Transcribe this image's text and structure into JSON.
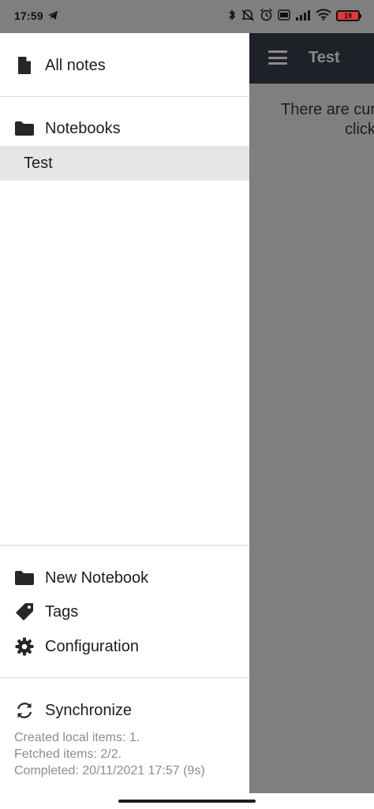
{
  "status_bar": {
    "time": "17:59",
    "battery_level": "19",
    "icons": [
      "telegram-icon",
      "bluetooth-icon",
      "mute-icon",
      "alarm-icon",
      "volte-icon",
      "signal-icon",
      "wifi-icon",
      "battery-icon"
    ]
  },
  "app_header": {
    "title": "Test",
    "menu_icon": "hamburger-icon"
  },
  "main": {
    "empty_line1": "There are cur",
    "empty_line2": "click"
  },
  "drawer": {
    "all_notes": {
      "label": "All notes",
      "icon": "file-icon"
    },
    "notebooks_header": {
      "label": "Notebooks",
      "icon": "folder-icon"
    },
    "notebooks": [
      {
        "label": "Test",
        "selected": true
      }
    ],
    "new_notebook": {
      "label": "New Notebook",
      "icon": "folder-icon"
    },
    "tags": {
      "label": "Tags",
      "icon": "tag-icon"
    },
    "configuration": {
      "label": "Configuration",
      "icon": "gear-icon"
    },
    "synchronize": {
      "label": "Synchronize",
      "icon": "sync-icon"
    },
    "sync_report": {
      "line1": "Created local items: 1.",
      "line2": "Fetched items: 2/2.",
      "line3": "Completed: 20/11/2021 17:57 (9s)"
    }
  },
  "colors": {
    "header_bg": "#1f2128",
    "overlay": "#7f7f7f",
    "selected_row": "#e6e6e6",
    "text": "#1d1d1d",
    "muted_text": "#8c8c8c"
  }
}
